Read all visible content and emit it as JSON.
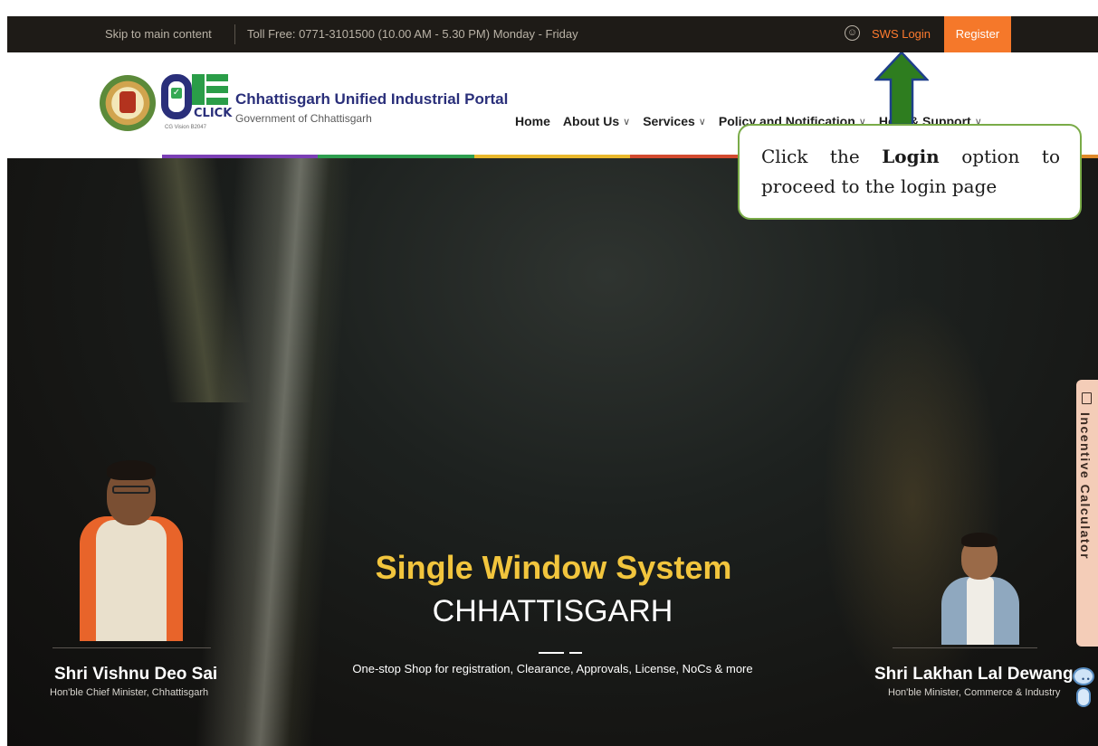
{
  "topbar": {
    "skip_link": "Skip to main content",
    "toll_free": "Toll Free: 0771-3101500 (10.00 AM - 5.30 PM) Monday - Friday",
    "accessibility_icon": "accessibility-icon",
    "sws_login": "SWS Login",
    "register": "Register"
  },
  "header": {
    "logo_word": "CLICK",
    "logo_tagline": "CG Vision B2047",
    "portal_title": "Chhattisgarh Unified Industrial Portal",
    "portal_subtitle": "Government of Chhattisgarh",
    "nav": [
      {
        "label": "Home",
        "has_dropdown": false
      },
      {
        "label": "About Us",
        "has_dropdown": true
      },
      {
        "label": "Services",
        "has_dropdown": true
      },
      {
        "label": "Policy and Notification",
        "has_dropdown": true
      },
      {
        "label": "Help & Support",
        "has_dropdown": true
      }
    ],
    "strip_colors": [
      "#7b3fb5",
      "#2e9e4f",
      "#e9b82c",
      "#d24a2f",
      "#3d6fc9",
      "#e08a2a"
    ]
  },
  "hero": {
    "title": "Single Window System",
    "state": "CHHATTISGARH",
    "description": "One-stop Shop for registration, Clearance, Approvals, License, NoCs & more",
    "minister_left": {
      "name": "Shri Vishnu Deo Sai",
      "role": "Hon'ble Chief Minister, Chhattisgarh"
    },
    "minister_right": {
      "name": "Shri Lakhan Lal Dewangan",
      "role": "Hon'ble Minister, Commerce & Industry"
    },
    "incentive_calculator": "Incentive Calculator"
  },
  "annotation": {
    "prefix": "Click the ",
    "bold": "Login",
    "suffix": " option to proceed to the login page"
  },
  "colors": {
    "accent_orange": "#f5782a",
    "title_gold": "#f2c53d",
    "callout_border": "#7aab48",
    "arrow_green": "#2e7d1f"
  }
}
